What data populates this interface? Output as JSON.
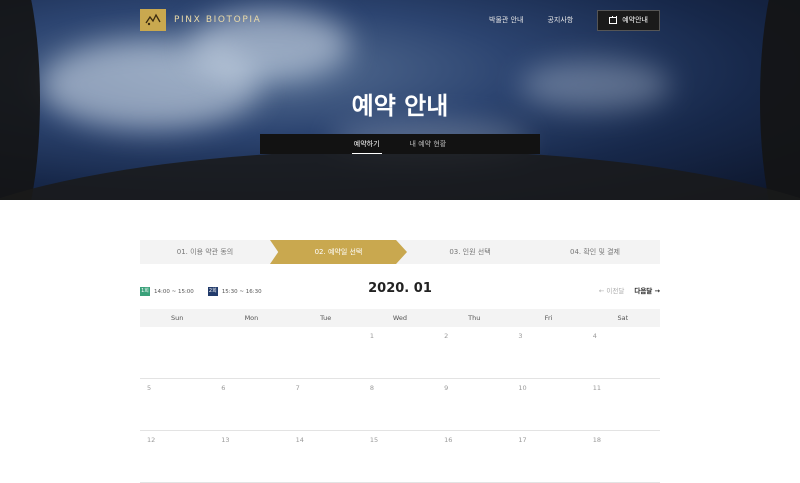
{
  "header": {
    "logo_text": "PINX BIOTOPIA",
    "nav": [
      "박물관 안내",
      "공지사항"
    ],
    "reserve_button": "예약안내"
  },
  "hero": {
    "title": "예약 안내",
    "tabs": [
      "예약하기",
      "내 예약 현황"
    ]
  },
  "steps": [
    "01. 이용 약관 동의",
    "02. 예약일 선택",
    "03. 인원 선택",
    "04. 확인 및 결제"
  ],
  "legend": [
    {
      "badge": "1회",
      "time": "14:00 ~ 15:00"
    },
    {
      "badge": "2회",
      "time": "15:30 ~ 16:30"
    }
  ],
  "calendar": {
    "month": "2020. 01",
    "prev": "← 이전달",
    "next": "다음달 →",
    "weekdays": [
      "Sun",
      "Mon",
      "Tue",
      "Wed",
      "Thu",
      "Fri",
      "Sat"
    ],
    "weeks": [
      [
        "",
        "",
        "",
        "1",
        "2",
        "3",
        "4"
      ],
      [
        "5",
        "6",
        "7",
        "8",
        "9",
        "10",
        "11"
      ],
      [
        "12",
        "13",
        "14",
        "15",
        "16",
        "17",
        "18"
      ]
    ]
  },
  "colors": {
    "accent": "#c9a84f",
    "session1": "#3aa17a",
    "session2": "#223b6b"
  }
}
